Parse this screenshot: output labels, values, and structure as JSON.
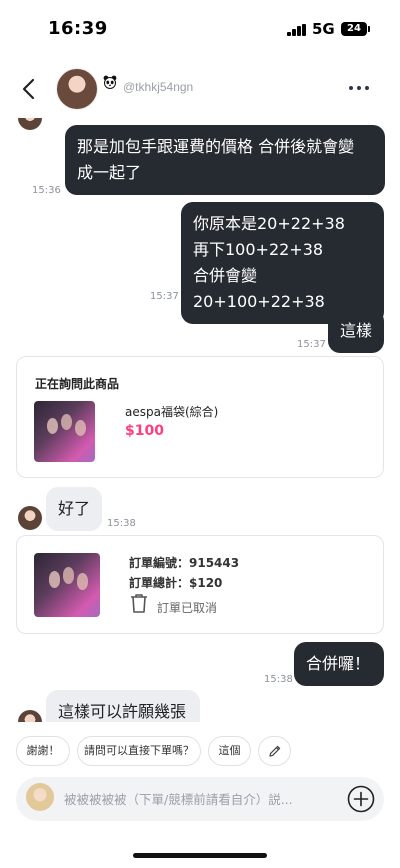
{
  "status_bar": {
    "time": "16:39",
    "network": "5G",
    "battery": "24"
  },
  "header": {
    "username": "@tkhkj54ngn",
    "back_icon": "chevron-left-icon",
    "more_icon": "more-dots-icon",
    "panda_icon": "panda-icon"
  },
  "messages": [
    {
      "side": "me",
      "lines": [
        "那是加包手跟運費的價格 合併後就會變",
        "成一起了"
      ],
      "time": "15:36"
    },
    {
      "side": "me",
      "lines": [
        "你原本是20+22+38",
        "再下100+22+38",
        "合併會變20+100+22+38"
      ],
      "time": "15:37"
    },
    {
      "side": "me",
      "lines": [
        "這樣"
      ],
      "time": "15:37"
    },
    {
      "side": "them",
      "lines": [
        "好了"
      ],
      "time": "15:38"
    },
    {
      "side": "me",
      "lines": [
        "合併囉！"
      ],
      "time": "15:38"
    },
    {
      "side": "them",
      "lines": [
        "這樣可以許願幾張"
      ],
      "time": ""
    }
  ],
  "inquiry_card": {
    "title": "正在詢問此商品",
    "product_name": "aespa福袋(綜合)",
    "price": "$100"
  },
  "order_card": {
    "order_no": "訂單編號：915443",
    "order_total": "訂單總計：$120",
    "status": "訂單已取消"
  },
  "quick_replies": [
    "謝謝！",
    "請問可以直接下單嗎？",
    "這個"
  ],
  "input": {
    "placeholder": "被被被被被（下單/競標前請看自介）説..."
  },
  "colors": {
    "me_bubble": "#262b31",
    "them_bubble": "#eceef2",
    "price": "#ff3d7f",
    "muted": "#8d929b"
  }
}
